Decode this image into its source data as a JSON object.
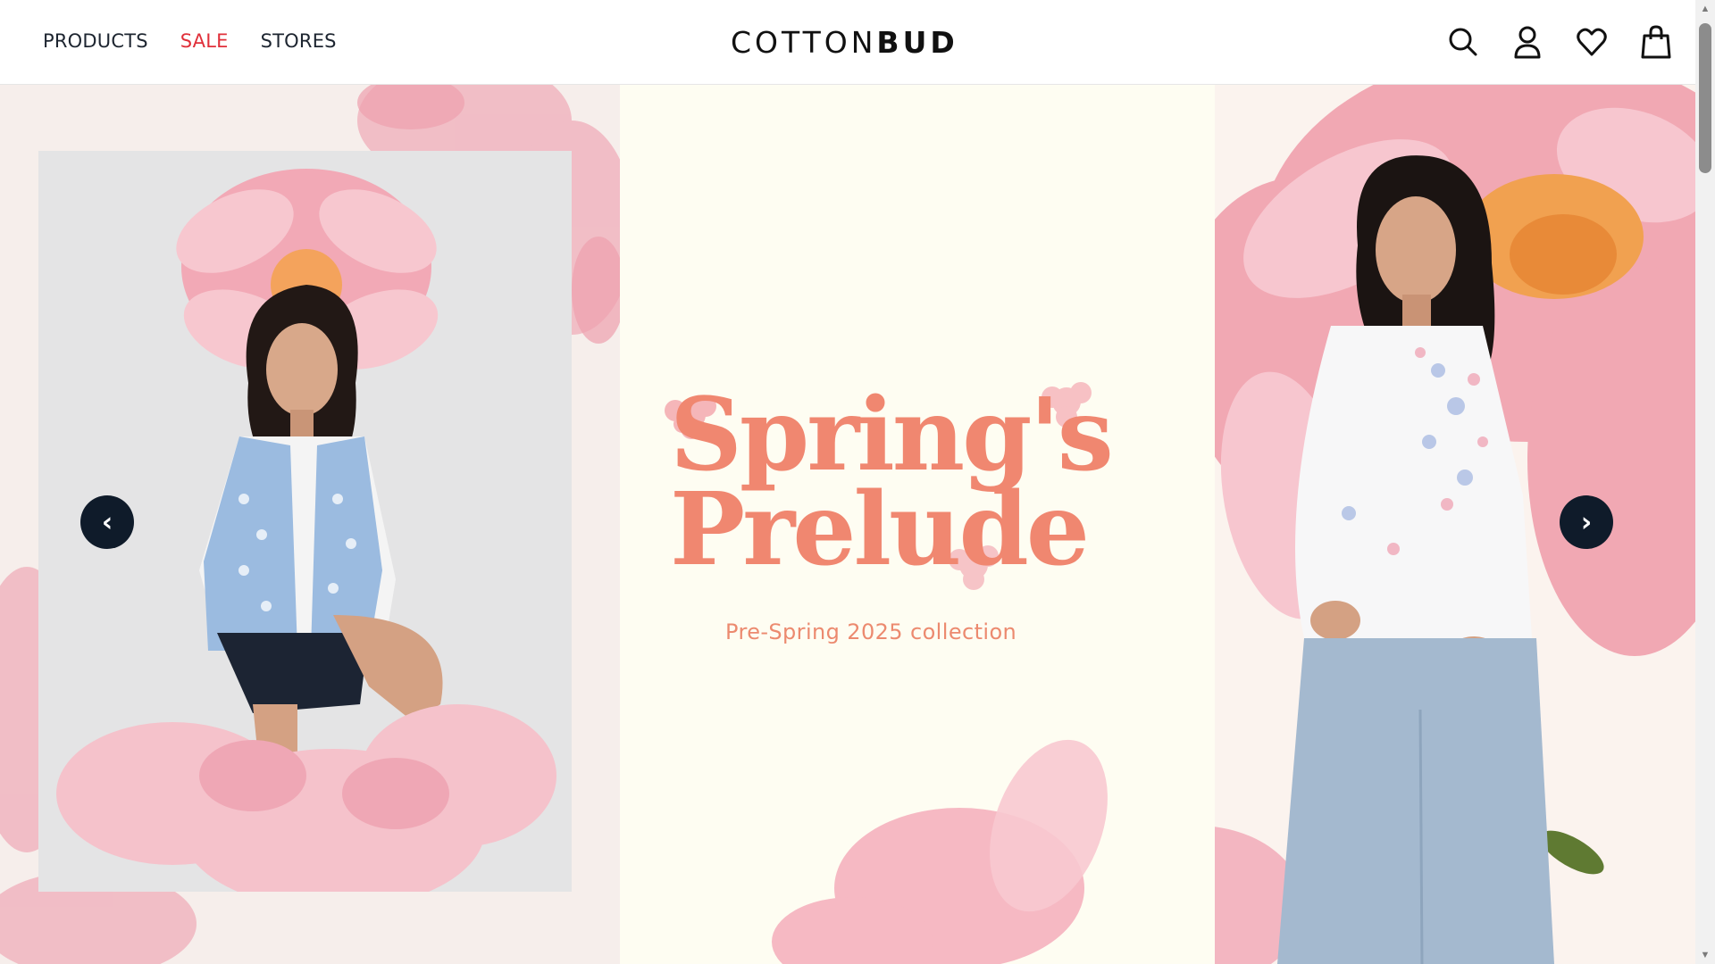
{
  "nav": {
    "products": "PRODUCTS",
    "sale": "SALE",
    "stores": "STORES"
  },
  "brand": {
    "logo_light": "COTTON",
    "logo_bold": "BUD"
  },
  "header_icons": [
    "search-icon",
    "account-icon",
    "wishlist-icon",
    "bag-icon"
  ],
  "hero": {
    "headline_line1": "Spring's",
    "headline_line2": "Prelude",
    "subtitle": "Pre-Spring 2025 collection",
    "prev_symbol": "‹",
    "next_symbol": "›"
  },
  "colors": {
    "accent": "#f08770",
    "sale": "#e0303a",
    "arrow_bg": "#0f1b2a",
    "center_bg": "#fefdf2",
    "left_bg": "#f6eeeb"
  }
}
